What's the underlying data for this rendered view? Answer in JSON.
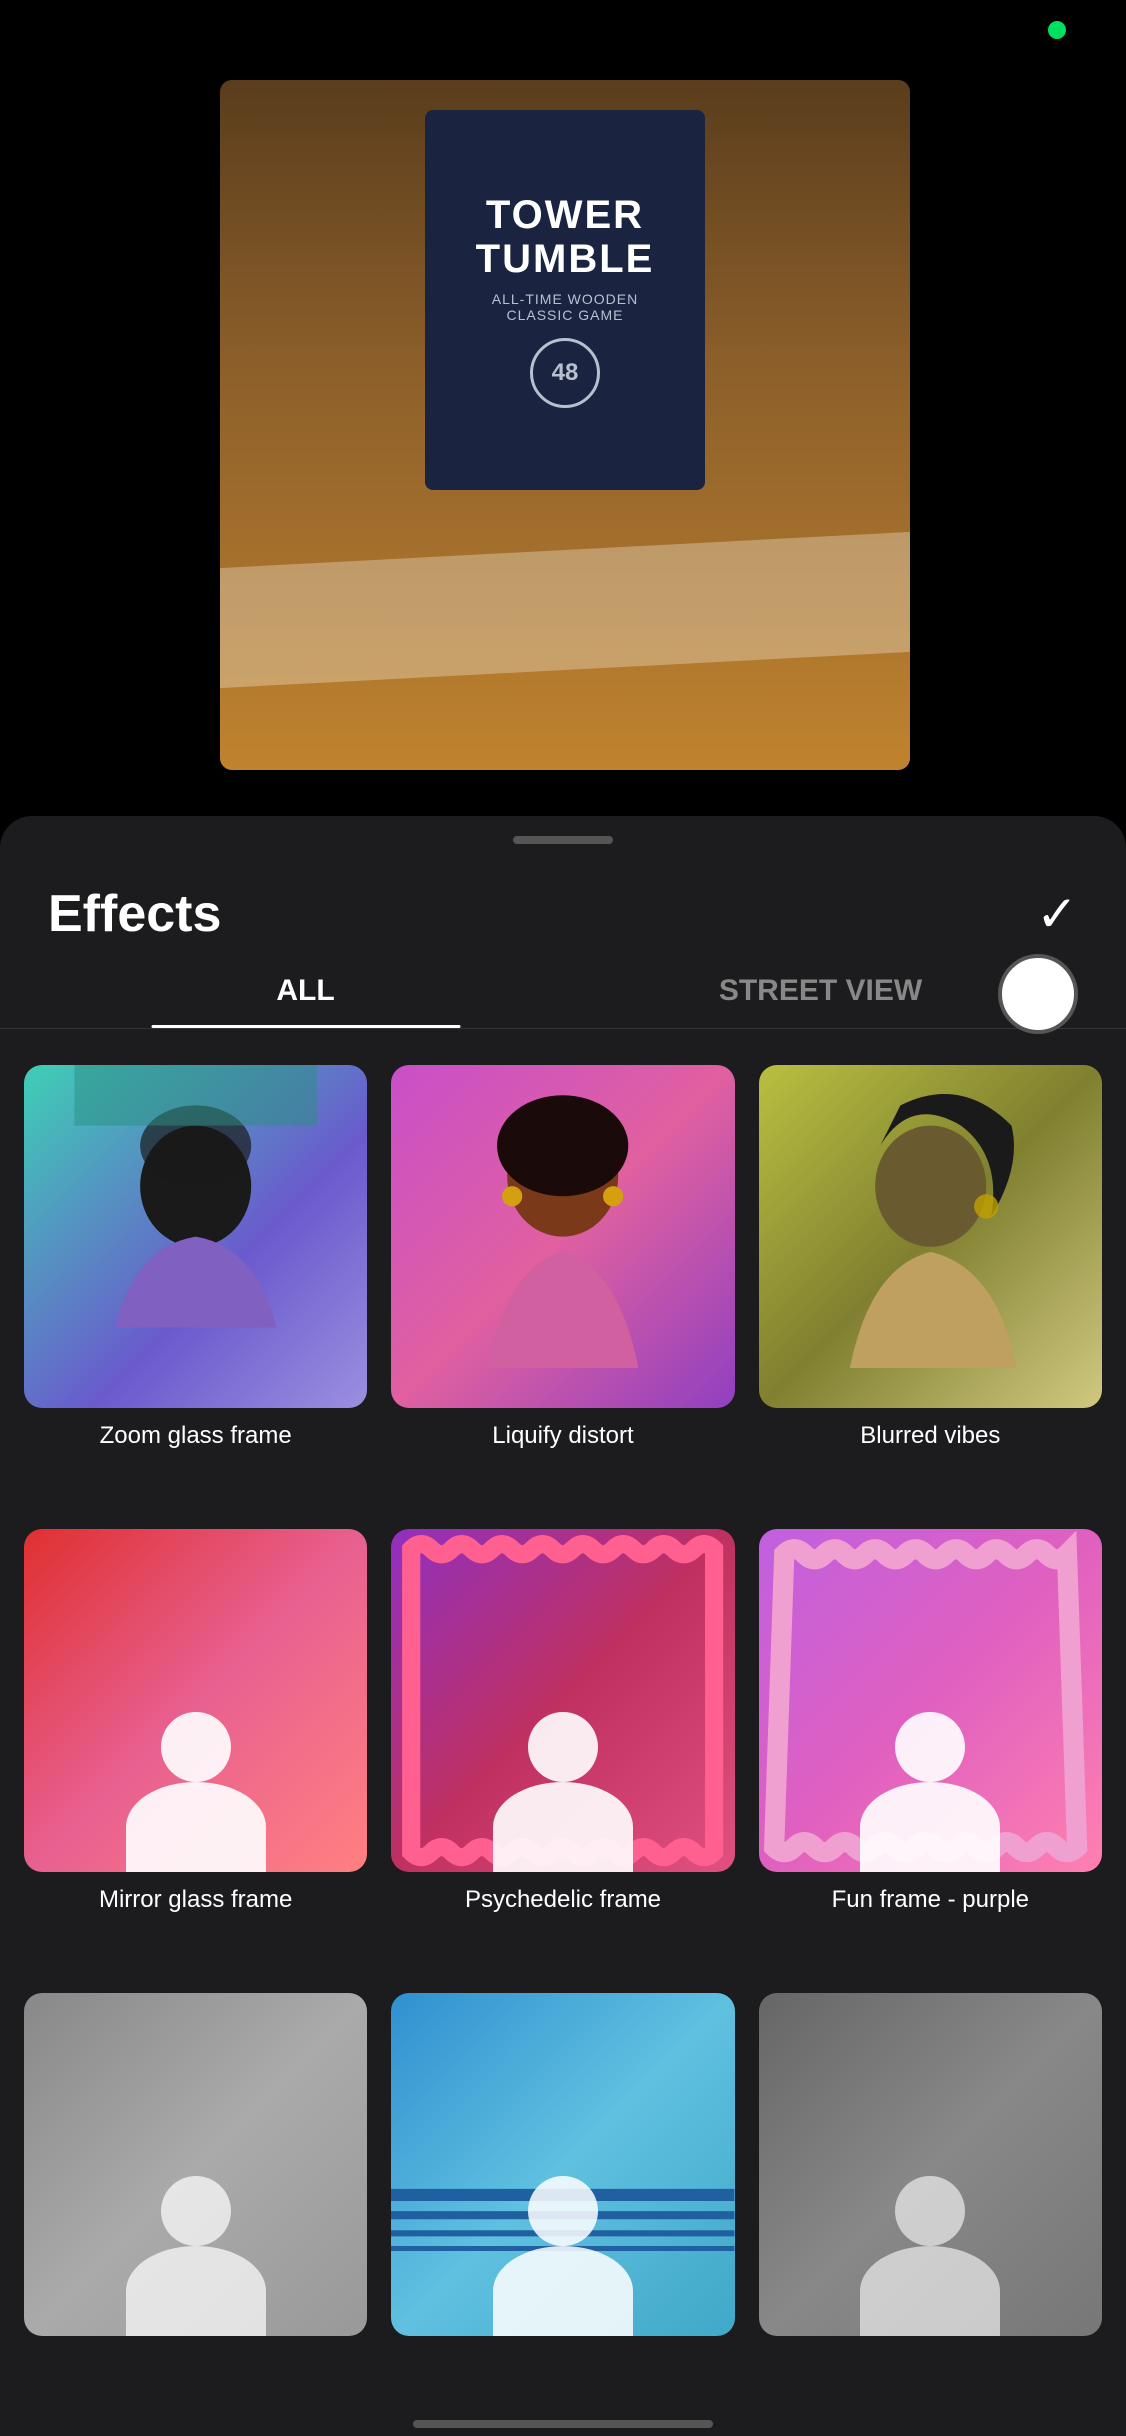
{
  "status": {
    "camera_indicator_color": "#00e060"
  },
  "game_box": {
    "title": "TOWER\nTUMBLE",
    "subtitle": "ALL-TIME WOODEN\nCLASSIC GAME",
    "badge": "48"
  },
  "header": {
    "effects_title": "Effects",
    "checkmark": "✓"
  },
  "tabs": [
    {
      "id": "all",
      "label": "ALL",
      "active": true
    },
    {
      "id": "streetview",
      "label": "STREET VIEW",
      "active": false
    }
  ],
  "effects": [
    {
      "id": "zoom-glass-frame",
      "label": "Zoom glass frame",
      "theme": "zoom-glass"
    },
    {
      "id": "liquify-distort",
      "label": "Liquify distort",
      "theme": "liquify"
    },
    {
      "id": "blurred-vibes",
      "label": "Blurred vibes",
      "theme": "blurred"
    },
    {
      "id": "mirror-glass-frame",
      "label": "Mirror glass frame",
      "theme": "mirror"
    },
    {
      "id": "psychedelic-frame",
      "label": "Psychedelic frame",
      "theme": "psychedelic"
    },
    {
      "id": "fun-frame-purple",
      "label": "Fun frame - purple",
      "theme": "funframe"
    },
    {
      "id": "effect-row3a",
      "label": "",
      "theme": "row3a"
    },
    {
      "id": "effect-row3b",
      "label": "",
      "theme": "row3b"
    },
    {
      "id": "effect-row3c",
      "label": "",
      "theme": "row3c"
    }
  ],
  "refresh_button": {
    "label": "↻"
  }
}
